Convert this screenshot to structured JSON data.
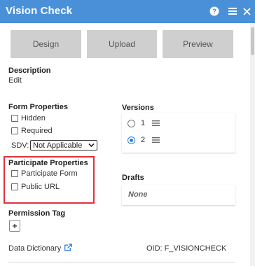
{
  "header": {
    "title": "Vision Check",
    "background": "#4a90d9",
    "icons": [
      "help-icon",
      "menu-icon",
      "close-icon"
    ]
  },
  "toolbar": {
    "design_label": "Design",
    "upload_label": "Upload",
    "preview_label": "Preview"
  },
  "description": {
    "heading": "Description",
    "edit_label": "Edit"
  },
  "form_properties": {
    "heading": "Form Properties",
    "hidden_label": "Hidden",
    "required_label": "Required",
    "sdv_label": "SDV:",
    "sdv_value": "Not Applicable"
  },
  "versions": {
    "heading": "Versions",
    "items": [
      {
        "number": "1",
        "selected": false
      },
      {
        "number": "2",
        "selected": true
      }
    ]
  },
  "participate_properties": {
    "heading": "Participate Properties",
    "participate_form_label": "Participate Form",
    "public_url_label": "Public URL",
    "highlight_color": "#e0313b"
  },
  "drafts": {
    "heading": "Drafts",
    "empty_text": "None"
  },
  "permission_tag": {
    "heading": "Permission Tag",
    "add_label": "+"
  },
  "footer": {
    "data_dictionary_label": "Data Dictionary",
    "oid_text": "OID: F_VISIONCHECK"
  }
}
